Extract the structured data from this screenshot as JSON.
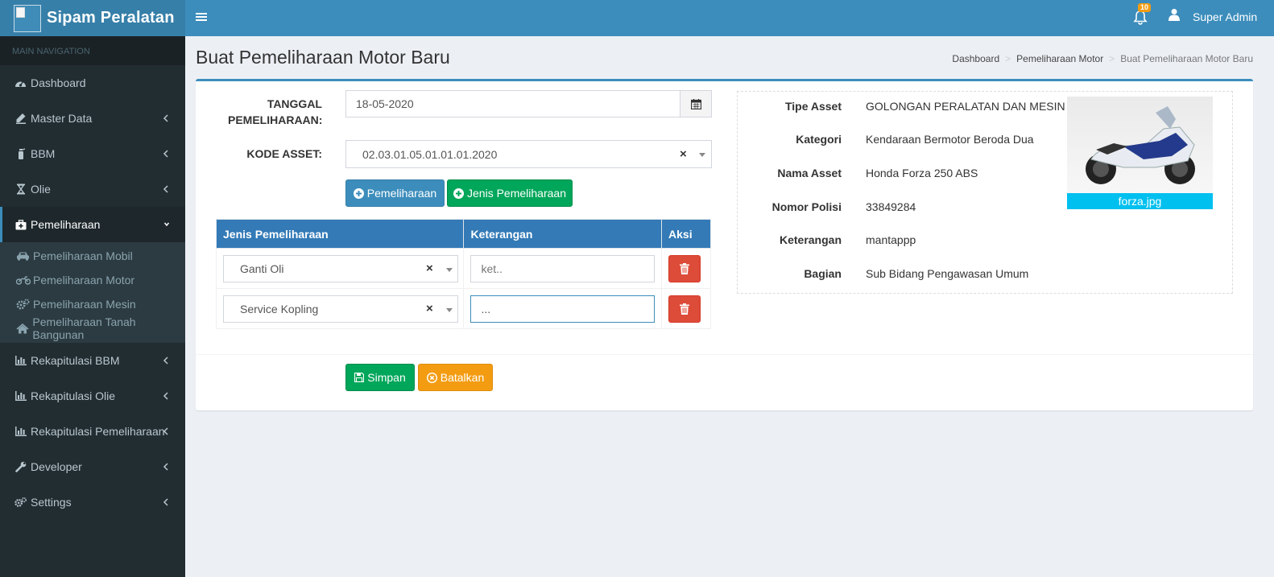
{
  "app": {
    "title": "Sipam Peralatan",
    "user": "Super Admin",
    "notif_count": "10"
  },
  "sidebar": {
    "header": "MAIN NAVIGATION",
    "items": [
      {
        "label": "Dashboard",
        "icon": "dashboard-icon"
      },
      {
        "label": "Master Data",
        "icon": "edit-icon"
      },
      {
        "label": "BBM",
        "icon": "fire-extinguisher-icon"
      },
      {
        "label": "Olie",
        "icon": "hourglass-icon"
      },
      {
        "label": "Pemeliharaan",
        "icon": "medkit-icon"
      },
      {
        "label": "Rekapitulasi BBM",
        "icon": "bar-chart-icon"
      },
      {
        "label": "Rekapitulasi Olie",
        "icon": "bar-chart-icon"
      },
      {
        "label": "Rekapitulasi Pemeliharaan",
        "icon": "bar-chart-icon"
      },
      {
        "label": "Developer",
        "icon": "wrench-icon"
      },
      {
        "label": "Settings",
        "icon": "gears-icon"
      }
    ],
    "sub_items": [
      {
        "label": "Pemeliharaan Mobil",
        "icon": "car-icon"
      },
      {
        "label": "Pemeliharaan Motor",
        "icon": "motorcycle-icon"
      },
      {
        "label": "Pemeliharaan Mesin",
        "icon": "cogs-icon"
      },
      {
        "label": "Pemeliharaan Tanah Bangunan",
        "icon": "home-icon"
      }
    ]
  },
  "page": {
    "title": "Buat Pemeliharaan Motor Baru",
    "breadcrumb": [
      "Dashboard",
      "Pemeliharaan Motor",
      "Buat Pemeliharaan Motor Baru"
    ]
  },
  "form": {
    "tanggal_label_1": "TANGGAL",
    "tanggal_label_2": "PEMELIHARAAN:",
    "tanggal_value": "18-05-2020",
    "kode_label": "KODE ASSET:",
    "kode_value": "02.03.01.05.01.01.01.2020",
    "btn_pemeliharaan": "Pemeliharaan",
    "btn_jenis": "Jenis Pemeliharaan",
    "table": {
      "headers": [
        "Jenis Pemeliharaan",
        "Keterangan",
        "Aksi"
      ],
      "rows": [
        {
          "jenis": "Ganti Oli",
          "keterangan_placeholder": "ket..",
          "keterangan": ""
        },
        {
          "jenis": "Service Kopling",
          "keterangan_placeholder": "",
          "keterangan": "..."
        }
      ]
    },
    "btn_simpan": "Simpan",
    "btn_batalkan": "Batalkan"
  },
  "asset": {
    "labels": [
      "Tipe Asset",
      "Kategori",
      "Nama Asset",
      "Nomor Polisi",
      "Keterangan",
      "Bagian"
    ],
    "values": [
      "GOLONGAN PERALATAN DAN MESIN",
      "Kendaraan Bermotor Beroda Dua",
      "Honda Forza 250 ABS",
      "33849284",
      "mantappp",
      "Sub Bidang Pengawasan Umum"
    ],
    "photo_caption": "forza.jpg"
  },
  "colors": {
    "brand": "#3c8dbc",
    "sidebar": "#222d32",
    "success": "#00a65a",
    "warning": "#f39c12",
    "danger": "#dd4b39",
    "info": "#00c0ef"
  }
}
